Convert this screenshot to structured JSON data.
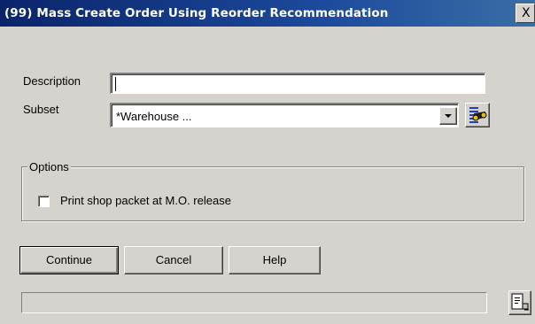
{
  "window": {
    "title": "(99) Mass Create Order Using Reorder Recommendation",
    "close_label": "X"
  },
  "form": {
    "description_label": "Description",
    "description_value": "",
    "subset_label": "Subset",
    "subset_value": "*Warehouse ..."
  },
  "options": {
    "group_title": "Options",
    "print_shop_packet_label": "Print shop packet at M.O. release",
    "print_shop_packet_checked": false
  },
  "buttons": {
    "continue_label": "Continue",
    "cancel_label": "Cancel",
    "help_label": "Help"
  },
  "colors": {
    "title_bar_start": "#0a246a",
    "title_bar_end": "#3a6ea5",
    "dialog_background": "#d6d3ce"
  },
  "icons": {
    "subset_lookup": "binoculars-list-icon",
    "status_right": "document-properties-icon",
    "dropdown": "chevron-down-icon"
  }
}
